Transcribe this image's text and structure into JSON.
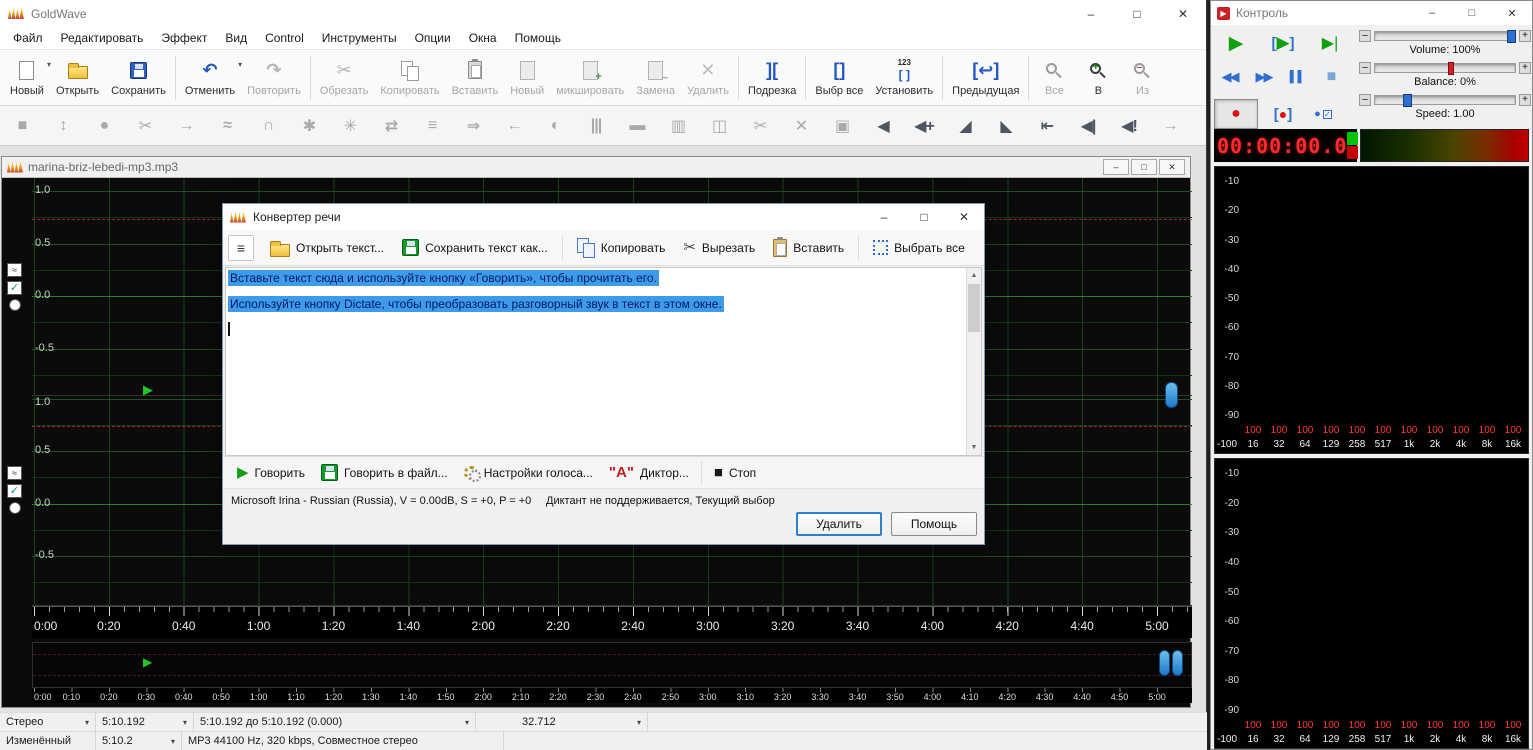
{
  "icon_glyphs": {
    "minimize": "–",
    "maximize": "□",
    "close": "✕",
    "restore": "□",
    "dropdown": "▾",
    "menu": "≡",
    "play": "▶",
    "play_end": "▶|",
    "rewind": "◀◀",
    "forward": "▶▶",
    "pause": "▌▌",
    "stop": "■",
    "record": "●",
    "check": "✓",
    "bracket_l": "[",
    "bracket_r": "]",
    "scroll_up": "▲",
    "scroll_down": "▼",
    "voice_a": "\"А\""
  },
  "goldwave": {
    "title": "GoldWave",
    "menu": [
      "Файл",
      "Редактировать",
      "Эффект",
      "Вид",
      "Control",
      "Инструменты",
      "Опции",
      "Окна",
      "Помощь"
    ],
    "toolbar": [
      {
        "n": "new",
        "l": "Новый",
        "i": "ic-page",
        "en": true,
        "dd": true
      },
      {
        "n": "open",
        "l": "Открыть",
        "i": "ic-folder",
        "en": true
      },
      {
        "n": "save",
        "l": "Сохранить",
        "i": "ic-floppy blue",
        "en": true,
        "sep": true
      },
      {
        "n": "undo",
        "l": "Отменить",
        "g": "↶",
        "c": "#2456c8",
        "en": true,
        "dd": true
      },
      {
        "n": "redo",
        "l": "Повторить",
        "g": "↷",
        "c": "#b4b4b4",
        "en": false,
        "sep": true
      },
      {
        "n": "cut",
        "l": "Обрезать",
        "g": "✂",
        "c": "#b4b4b4",
        "en": false
      },
      {
        "n": "copy",
        "l": "Копировать",
        "i": "ic-copy",
        "en": false
      },
      {
        "n": "paste",
        "l": "Вставить",
        "i": "ic-paste",
        "en": false
      },
      {
        "n": "paste-new",
        "l": "Новый",
        "i": "ic-page gray",
        "en": false
      },
      {
        "n": "mix",
        "l": "микшировать",
        "i": "ic-page gray plus",
        "en": false
      },
      {
        "n": "replace",
        "l": "Замена",
        "i": "ic-page gray swap",
        "en": false
      },
      {
        "n": "delete",
        "l": "Удалить",
        "g": "✕",
        "c": "#bcbcbc",
        "en": false,
        "sep": true
      },
      {
        "n": "trim",
        "l": "Подрезка",
        "g": "][",
        "c": "#2456c8",
        "en": true,
        "sep": true
      },
      {
        "n": "select-all",
        "l": "Выбр все",
        "g": "[]",
        "c": "#2456c8",
        "en": true
      },
      {
        "n": "set-selection",
        "l": "Установить",
        "i": "ic-123",
        "en": true,
        "sep": true
      },
      {
        "n": "previous",
        "l": "Предыдущая",
        "g": "[↩]",
        "c": "#2456c8",
        "en": true,
        "sep": true
      },
      {
        "n": "zoom-all",
        "l": "Все",
        "i": "ic-zoom",
        "en": false
      },
      {
        "n": "zoom-in",
        "l": "В",
        "i": "ic-zoom zin",
        "en": true
      },
      {
        "n": "zoom-out",
        "l": "Из",
        "i": "ic-zoom zout",
        "en": false
      }
    ],
    "effects": [
      {
        "n": "square",
        "g": "■",
        "c": "#a9a9a9"
      },
      {
        "n": "swap-updown",
        "g": "↕",
        "c": "#a9a9a9"
      },
      {
        "n": "circle",
        "g": "●",
        "c": "#a9a9a9"
      },
      {
        "n": "cut-x",
        "g": "✂",
        "c": "#a9a9a9"
      },
      {
        "n": "arrow-right",
        "g": "→",
        "c": "#a9a9a9"
      },
      {
        "n": "wave",
        "g": "≈",
        "c": "#a9a9a9"
      },
      {
        "n": "arch",
        "g": "∩",
        "c": "#a9a9a9"
      },
      {
        "n": "flower-a",
        "g": "✱",
        "c": "#a9a9a9"
      },
      {
        "n": "flower-b",
        "g": "✳",
        "c": "#a9a9a9"
      },
      {
        "n": "exchange",
        "g": "⇄",
        "c": "#a9a9a9"
      },
      {
        "n": "eq-list",
        "g": "≡",
        "c": "#a9a9a9"
      },
      {
        "n": "arrow-double",
        "g": "⇒",
        "c": "#a9a9a9"
      },
      {
        "n": "arrow-left",
        "g": "←",
        "c": "#a9a9a9"
      },
      {
        "n": "half-moon",
        "g": "◐",
        "c": "#a9a9a9"
      },
      {
        "n": "sliders",
        "g": "|||",
        "c": "#a9a9a9"
      },
      {
        "n": "disc",
        "g": "▬",
        "c": "#a9a9a9"
      },
      {
        "n": "barrel",
        "g": "▥",
        "c": "#a9a9a9"
      },
      {
        "n": "window-split",
        "g": "◫",
        "c": "#a9a9a9"
      },
      {
        "n": "scissors",
        "g": "✂",
        "c": "#a9a9a9"
      },
      {
        "n": "cross",
        "g": "✕",
        "c": "#a9a9a9"
      },
      {
        "n": "cart",
        "g": "▣",
        "c": "#a9a9a9"
      },
      {
        "n": "speaker",
        "g": "◀",
        "c": "#4d5560"
      },
      {
        "n": "speaker-plus",
        "g": "◀+",
        "c": "#4d5560"
      },
      {
        "n": "ramp-up",
        "g": "◢",
        "c": "#4d5560"
      },
      {
        "n": "ramp-down",
        "g": "◣",
        "c": "#4d5560"
      },
      {
        "n": "to-start",
        "g": "⇤",
        "c": "#4d5560"
      },
      {
        "n": "speaker-bar",
        "g": "◀|",
        "c": "#4d5560"
      },
      {
        "n": "speaker-alert",
        "g": "◀!",
        "c": "#4d5560"
      },
      {
        "n": "final-arrow",
        "g": "→",
        "c": "#a9a9a9"
      }
    ],
    "audio": {
      "title": "marina-briz-lebedi-mp3.mp3",
      "amp": [
        "1.0",
        "0.5",
        "0.0",
        "-0.5"
      ],
      "ruler": [
        "0:00",
        "0:20",
        "0:40",
        "1:00",
        "1:20",
        "1:40",
        "2:00",
        "2:20",
        "2:40",
        "3:00",
        "3:20",
        "3:40",
        "4:00",
        "4:20",
        "4:40",
        "5:00"
      ],
      "overview_ruler": [
        "0:00",
        "0:10",
        "0:20",
        "0:30",
        "0:40",
        "0:50",
        "1:00",
        "1:10",
        "1:20",
        "1:30",
        "1:40",
        "1:50",
        "2:00",
        "2:10",
        "2:20",
        "2:30",
        "2:40",
        "2:50",
        "3:00",
        "3:10",
        "3:20",
        "3:30",
        "3:40",
        "3:50",
        "4:00",
        "4:10",
        "4:20",
        "4:30",
        "4:40",
        "4:50",
        "5:00"
      ]
    },
    "status1": [
      {
        "t": "Стерео",
        "a": true
      },
      {
        "t": "5:10.192",
        "a": true
      },
      {
        "t": "5:10.192 до 5:10.192 (0.000)",
        "a": true
      },
      {
        "t": "32.712",
        "a": true
      }
    ],
    "status2": [
      {
        "t": "Изменённый",
        "a": false
      },
      {
        "t": "5:10.2",
        "a": true
      },
      {
        "t": "MP3 44100 Hz, 320 kbps, Совместное стерео",
        "a": false
      }
    ]
  },
  "dialog": {
    "title": "Конвертер речи",
    "toolbar": [
      {
        "n": "open-text",
        "l": "Открыть текст...",
        "i": "ic-folder"
      },
      {
        "n": "save-text-as",
        "l": "Сохранить текст как...",
        "i": "ic-floppy green",
        "sep": true
      },
      {
        "n": "copy",
        "l": "Копировать",
        "i": "ic-copy blue"
      },
      {
        "n": "cut",
        "l": "Вырезать",
        "g": "✂",
        "c": "#444"
      },
      {
        "n": "paste",
        "l": "Вставить",
        "i": "ic-paste tan",
        "sep": true
      },
      {
        "n": "select-all",
        "l": "Выбрать все",
        "i": "ic-selall"
      }
    ],
    "lines": [
      "Вставьте текст сюда и используйте кнопку «Говорить», чтобы прочитать его.",
      "Используйте кнопку Dictate, чтобы преобразовать разговорный звук в текст в этом окне."
    ],
    "actions": [
      {
        "n": "speak",
        "l": "Говорить",
        "g": "▶",
        "c": "#12a012"
      },
      {
        "n": "speak-to-file",
        "l": "Говорить в файл...",
        "i": "ic-floppy green"
      },
      {
        "n": "voice-settings",
        "l": "Настройки голоса...",
        "i": "ic-gears"
      },
      {
        "n": "narrator",
        "l": "Диктор...",
        "g": "\"А\"",
        "c": "#c02020",
        "sep": true
      },
      {
        "n": "stop",
        "l": "Стоп",
        "g": "■",
        "c": "#1a1a1a"
      }
    ],
    "status_left": "Microsoft Irina - Russian (Russia), V = 0.00dB, S = +0, P = +0",
    "status_right": "Диктант не поддерживается, Текущий выбор",
    "delete_btn": "Удалить",
    "help_btn": "Помощь"
  },
  "control": {
    "title": "Контроль",
    "volume": "Volume: 100%",
    "balance": "Balance: 0%",
    "speed": "Speed: 1.00",
    "time": "00:00:00.0",
    "spectrum": {
      "db": [
        "-10",
        "-20",
        "-30",
        "-40",
        "-50",
        "-60",
        "-70",
        "-80",
        "-90"
      ],
      "corner": "-100",
      "levels": [
        "100",
        "100",
        "100",
        "100",
        "100",
        "100",
        "100",
        "100",
        "100",
        "100",
        "100"
      ],
      "freq": [
        "16",
        "32",
        "64",
        "129",
        "258",
        "517",
        "1k",
        "2k",
        "4k",
        "8k",
        "16k"
      ]
    }
  }
}
